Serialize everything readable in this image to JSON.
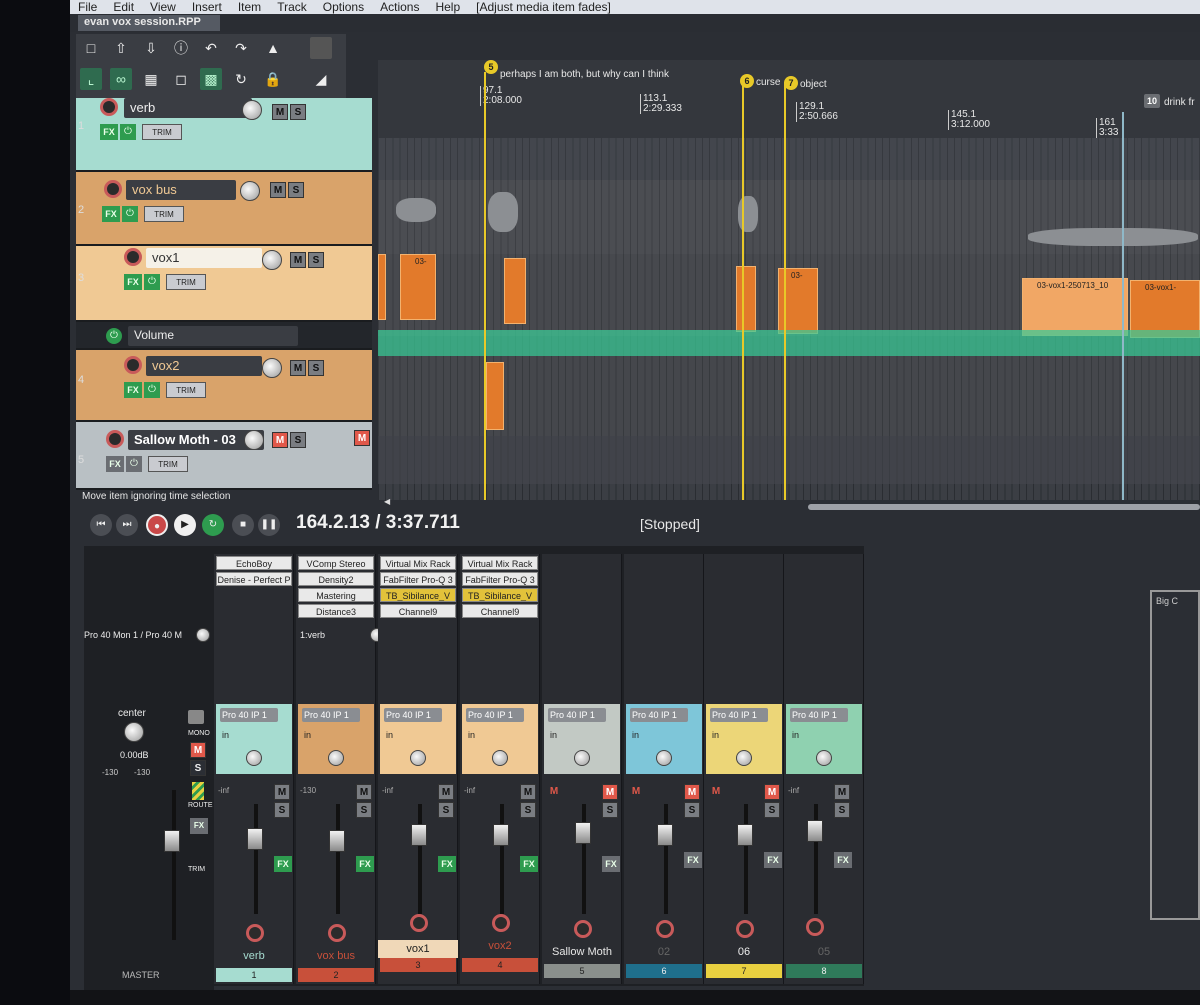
{
  "menu": [
    "File",
    "Edit",
    "View",
    "Insert",
    "Item",
    "Track",
    "Options",
    "Actions",
    "Help",
    "[Adjust media item fades]"
  ],
  "window": {
    "tab_title": "evan vox session.RPP"
  },
  "toolbar": {
    "row1": [
      "new-icon",
      "open-icon",
      "save-icon",
      "info-icon",
      "undo-icon",
      "redo-icon",
      "metronome-icon",
      "blank-icon"
    ],
    "row2": [
      "ripple-icon",
      "link-icon",
      "grid-icon",
      "group-icon",
      "snap-icon",
      "loop-icon",
      "lock-icon",
      "envelope-icon"
    ]
  },
  "tracks": [
    {
      "num": "1",
      "name": "verb",
      "color": "#a6dcd0"
    },
    {
      "num": "2",
      "name": "vox bus",
      "color": "#d9a36a"
    },
    {
      "num": "3",
      "name": "vox1",
      "color": "#f0c994"
    },
    {
      "num": "4",
      "name": "vox2",
      "color": "#d9a36a"
    },
    {
      "num": "5",
      "name": "Sallow Moth - 03",
      "color": "#b9c0c4"
    }
  ],
  "volume_envelope_label": "Volume",
  "tcp_labels": {
    "fx": "FX",
    "m": "M",
    "s": "S",
    "trim": "TRIM",
    "record_m": "M"
  },
  "status_hint": "Move item ignoring time selection",
  "markers": [
    {
      "id": "5",
      "name": "perhaps I am both, but why can I think"
    },
    {
      "id": "6",
      "name": "curse"
    },
    {
      "id": "7",
      "name": "object"
    },
    {
      "id": "10",
      "name": "drink fr"
    }
  ],
  "ruler": [
    {
      "bar": "97.1",
      "time": "2:08.000"
    },
    {
      "bar": "113.1",
      "time": "2:29.333"
    },
    {
      "bar": "129.1",
      "time": "2:50.666"
    },
    {
      "bar": "145.1",
      "time": "3:12.000"
    },
    {
      "bar": "161",
      "time": "3:33"
    }
  ],
  "items": {
    "small_label": "03-",
    "long1": "03-vox1-250713_10",
    "long2": "03-vox1-"
  },
  "transport": {
    "position": "164.2.13 / 3:37.711",
    "state": "[Stopped]"
  },
  "mixer": {
    "fx_columns": [
      {
        "slots": [
          "EchoBoy",
          "Denise - Perfect P"
        ]
      },
      {
        "slots": [
          "VComp Stereo",
          "Density2",
          "Mastering",
          "Distance3"
        ]
      },
      {
        "slots": [
          "Virtual Mix Rack",
          "FabFilter Pro-Q 3",
          "TB_Sibilance_V",
          "Channel9"
        ]
      },
      {
        "slots": [
          "Virtual Mix Rack",
          "FabFilter Pro-Q 3",
          "TB_Sibilance_V",
          "Channel9"
        ]
      }
    ],
    "master_sends_label": "Pro 40 Mon 1 / Pro 40 M",
    "send_label": "1:verb",
    "io_label": "Pro 40 IP 1",
    "in_label": "in",
    "fx_label": "FX",
    "master": {
      "pan": "center",
      "vol": "0.00dB",
      "peaks": [
        "-130",
        "-130"
      ],
      "mono": "MONO",
      "route": "ROUTE",
      "trim": "TRIM",
      "label": "MASTER"
    },
    "strips": [
      {
        "name": "verb",
        "num": "1",
        "color": "#a6dcd0",
        "peak": "-inf"
      },
      {
        "name": "vox bus",
        "num": "2",
        "color": "#d9a36a",
        "peak": "-130"
      },
      {
        "name": "vox1",
        "num": "3",
        "color": "#f0c994",
        "peak": "-inf"
      },
      {
        "name": "vox2",
        "num": "4",
        "color": "#d9a36a",
        "peak": "-inf"
      },
      {
        "name": "Sallow Moth",
        "num": "5",
        "color": "#c2c9c4",
        "peak": ""
      },
      {
        "name": "02",
        "num": "6",
        "color": "#7ec6d9",
        "peak": ""
      },
      {
        "name": "06",
        "num": "7",
        "color": "#ecd678",
        "peak": ""
      },
      {
        "name": "05",
        "num": "8",
        "color": "#8fd1b0",
        "peak": "-inf"
      }
    ]
  },
  "right_panel_label": "Big C"
}
